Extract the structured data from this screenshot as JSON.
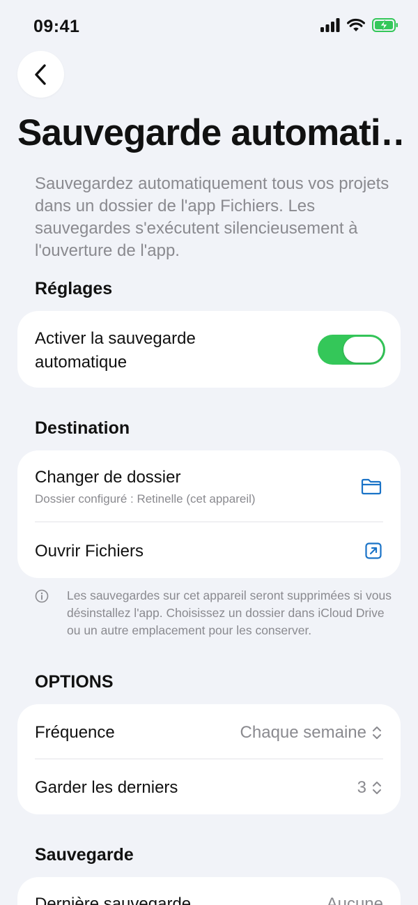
{
  "status_bar": {
    "time": "09:41",
    "icons": [
      "cellular-signal-icon",
      "wifi-icon",
      "battery-charging-icon"
    ],
    "battery_color": "#34c759"
  },
  "header": {
    "back_icon": "chevron-left-icon",
    "title": "Sauvegarde automati…",
    "description": "Sauvegardez automatiquement tous vos projets dans un dossier de l'app Fichiers. Les sauvegardes s'exécutent silencieusement à l'ouverture de l'app."
  },
  "settings": {
    "header": "Réglages",
    "auto_backup_label_line1": "Activer la sauvegarde",
    "auto_backup_label_line2": "automatique",
    "auto_backup_enabled": true,
    "toggle_color": "#34c759"
  },
  "destination": {
    "header": "Destination",
    "change_folder_label": "Changer de dossier",
    "configured_folder": "Dossier configuré : Retinelle (cet appareil)",
    "change_folder_icon": "folder-icon",
    "open_files_label": "Ouvrir Fichiers",
    "open_files_icon": "open-external-icon",
    "accent_color": "#1a73c7",
    "note_icon": "info-icon",
    "note": "Les sauvegardes sur cet appareil seront supprimées si vous désinstallez l'app. Choisissez un dossier dans iCloud Drive ou un autre emplacement pour les conserver."
  },
  "options": {
    "header": "OPTIONS",
    "frequency_label": "Fréquence",
    "frequency_value": "Chaque semaine",
    "keep_label": "Garder les derniers",
    "keep_value": "3",
    "stepper_icon": "chevron-up-down-icon"
  },
  "backup": {
    "header": "Sauvegarde",
    "last_backup_label": "Dernière sauvegarde",
    "last_backup_value": "Aucune"
  }
}
